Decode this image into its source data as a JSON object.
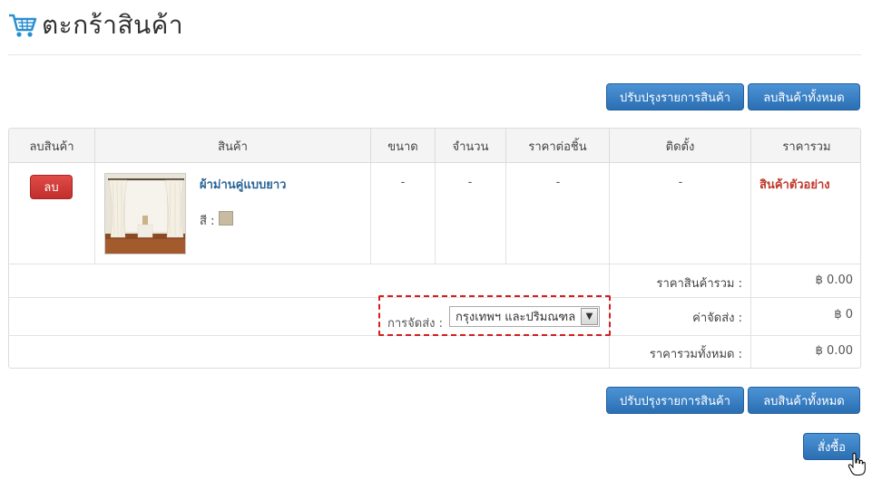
{
  "header": {
    "title": "ตะกร้าสินค้า",
    "icon": "shopping-cart-icon",
    "accent_color": "#2a8fd1"
  },
  "actions": {
    "update_label": "ปรับปรุงรายการสินค้า",
    "clear_label": "ลบสินค้าทั้งหมด",
    "order_label": "สั่งซื้อ"
  },
  "table": {
    "columns": [
      "ลบสินค้า",
      "สินค้า",
      "ขนาด",
      "จำนวน",
      "ราคาต่อชิ้น",
      "ติดตั้ง",
      "ราคารวม"
    ],
    "items": [
      {
        "delete_label": "ลบ",
        "name": "ผ้าม่านคู่แบบยาว",
        "color_label": "สี :",
        "color_hex": "#c8bba3",
        "size": "-",
        "quantity": "-",
        "unit_price": "-",
        "install": "-",
        "total": "สินค้าตัวอย่าง"
      }
    ]
  },
  "summary": {
    "subtotal_label": "ราคาสินค้ารวม :",
    "subtotal_value": "฿ 0.00",
    "shipping_label": "ค่าจัดส่ง :",
    "shipping_value": "฿ 0",
    "grand_total_label": "ราคารวมทั้งหมด :",
    "grand_total_value": "฿ 0.00"
  },
  "shipping": {
    "label": "การจัดส่ง :",
    "selected": "กรุงเทพฯ และปริมณฑล"
  },
  "colors": {
    "primary_button": "#2b6fb3",
    "danger_button": "#c12e2b",
    "price_text": "#c0392b",
    "highlight_dash": "#d21e1e"
  }
}
